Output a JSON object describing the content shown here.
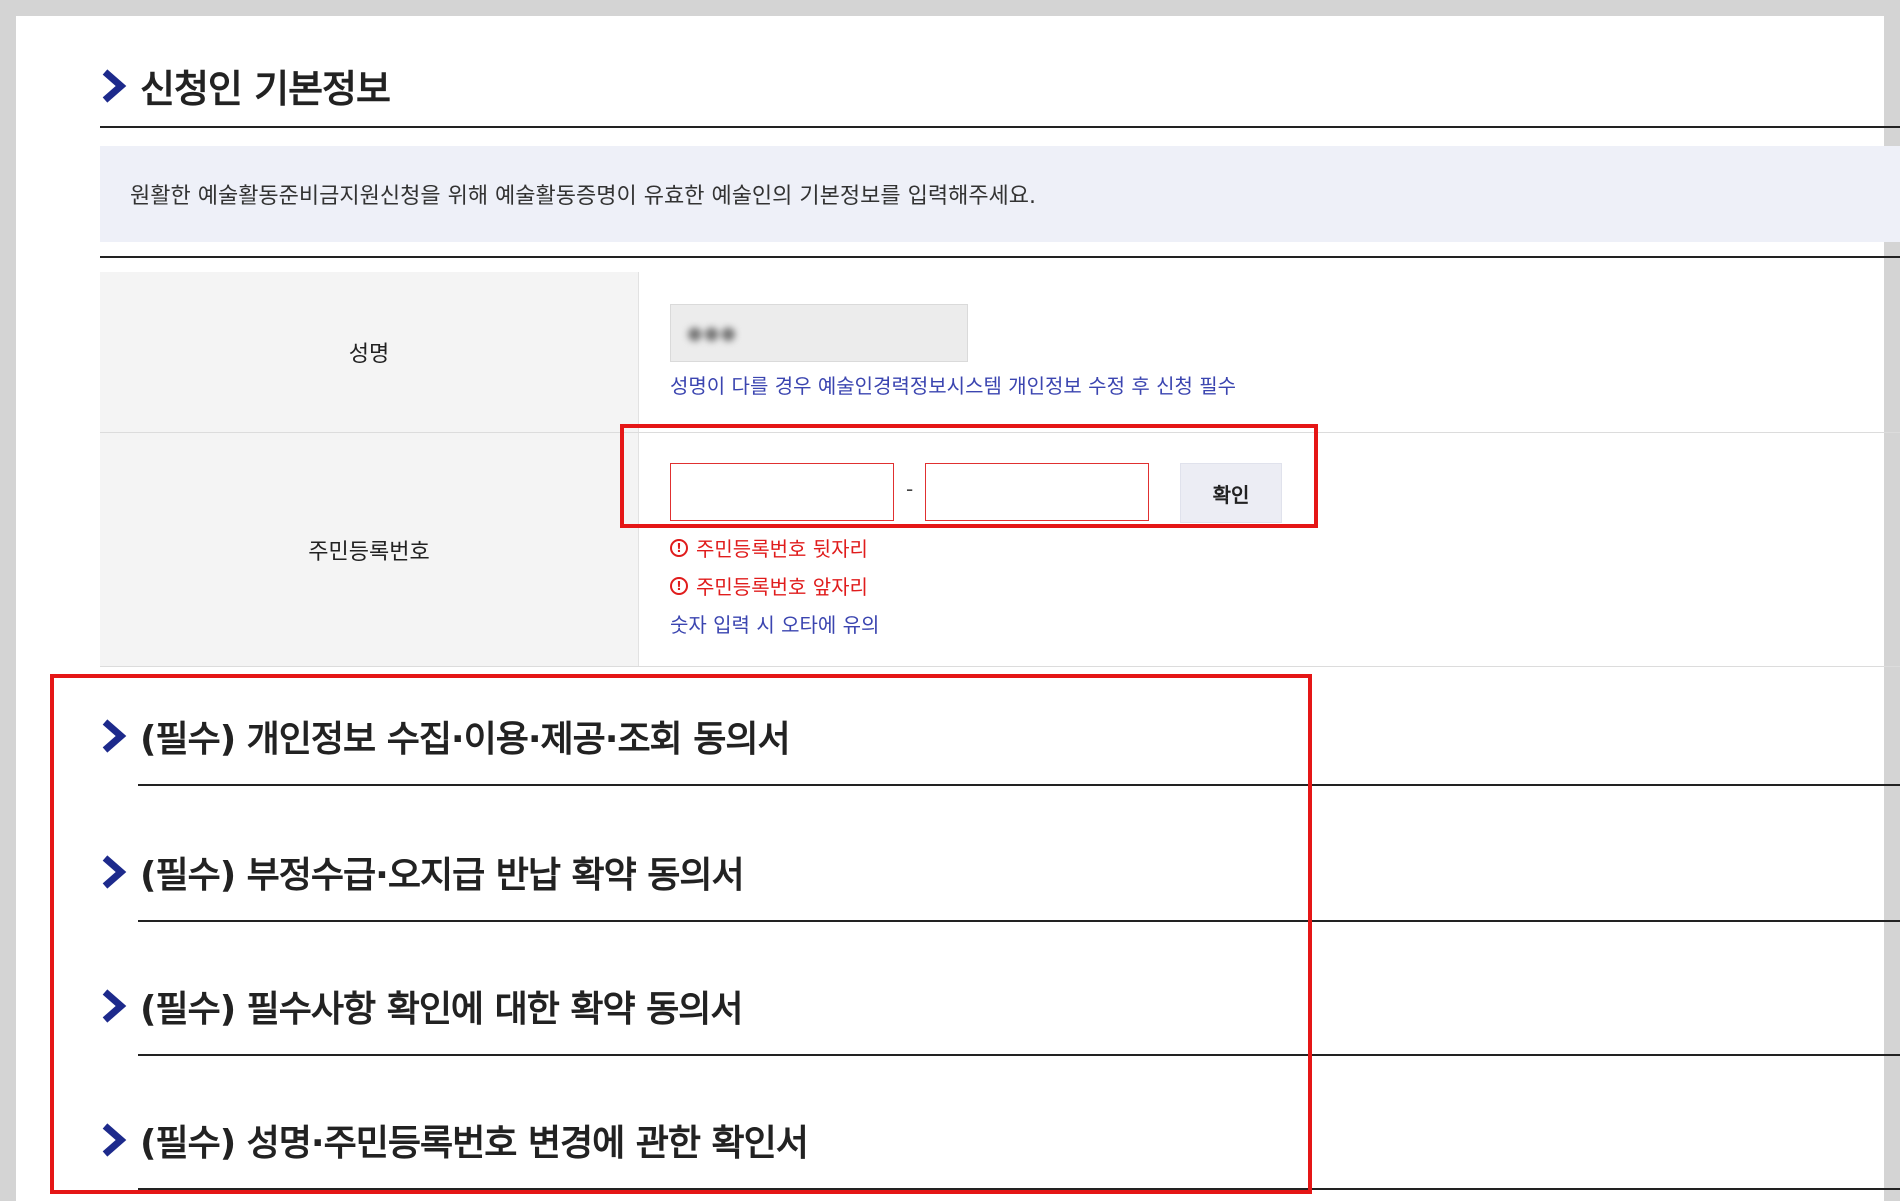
{
  "section": {
    "title": "신청인 기본정보",
    "notice": "원활한 예술활동준비금지원신청을 위해 예술활동증명이 유효한 예술인의 기본정보를 입력해주세요."
  },
  "form": {
    "name": {
      "label": "성명",
      "value": "●●●",
      "hint": "성명이 다를 경우 예술인경력정보시스템 개인정보 수정 후 신청 필수"
    },
    "rrn": {
      "label": "주민등록번호",
      "front_value": "",
      "back_value": "",
      "dash": "-",
      "confirm_label": "확인",
      "error_back": "주민등록번호 뒷자리",
      "error_front": "주민등록번호 앞자리",
      "hint": "숫자 입력 시 오타에 유의"
    }
  },
  "consents": [
    {
      "title": "(필수) 개인정보 수집·이용·제공·조회 동의서"
    },
    {
      "title": "(필수) 부정수급·오지급 반납 확약 동의서"
    },
    {
      "title": "(필수) 필수사항 확인에 대한 확약 동의서"
    },
    {
      "title": "(필수) 성명·주민등록번호 변경에 관한 확인서"
    }
  ],
  "icons": {
    "chevron": "chevron-right-icon",
    "warning": "exclamation-circle-icon"
  },
  "colors": {
    "accent_navy": "#1d2a8c",
    "highlight_red": "#e51616",
    "error_red": "#e01c1c",
    "hint_blue": "#3b45b0",
    "notice_bg": "#eef0f8"
  }
}
